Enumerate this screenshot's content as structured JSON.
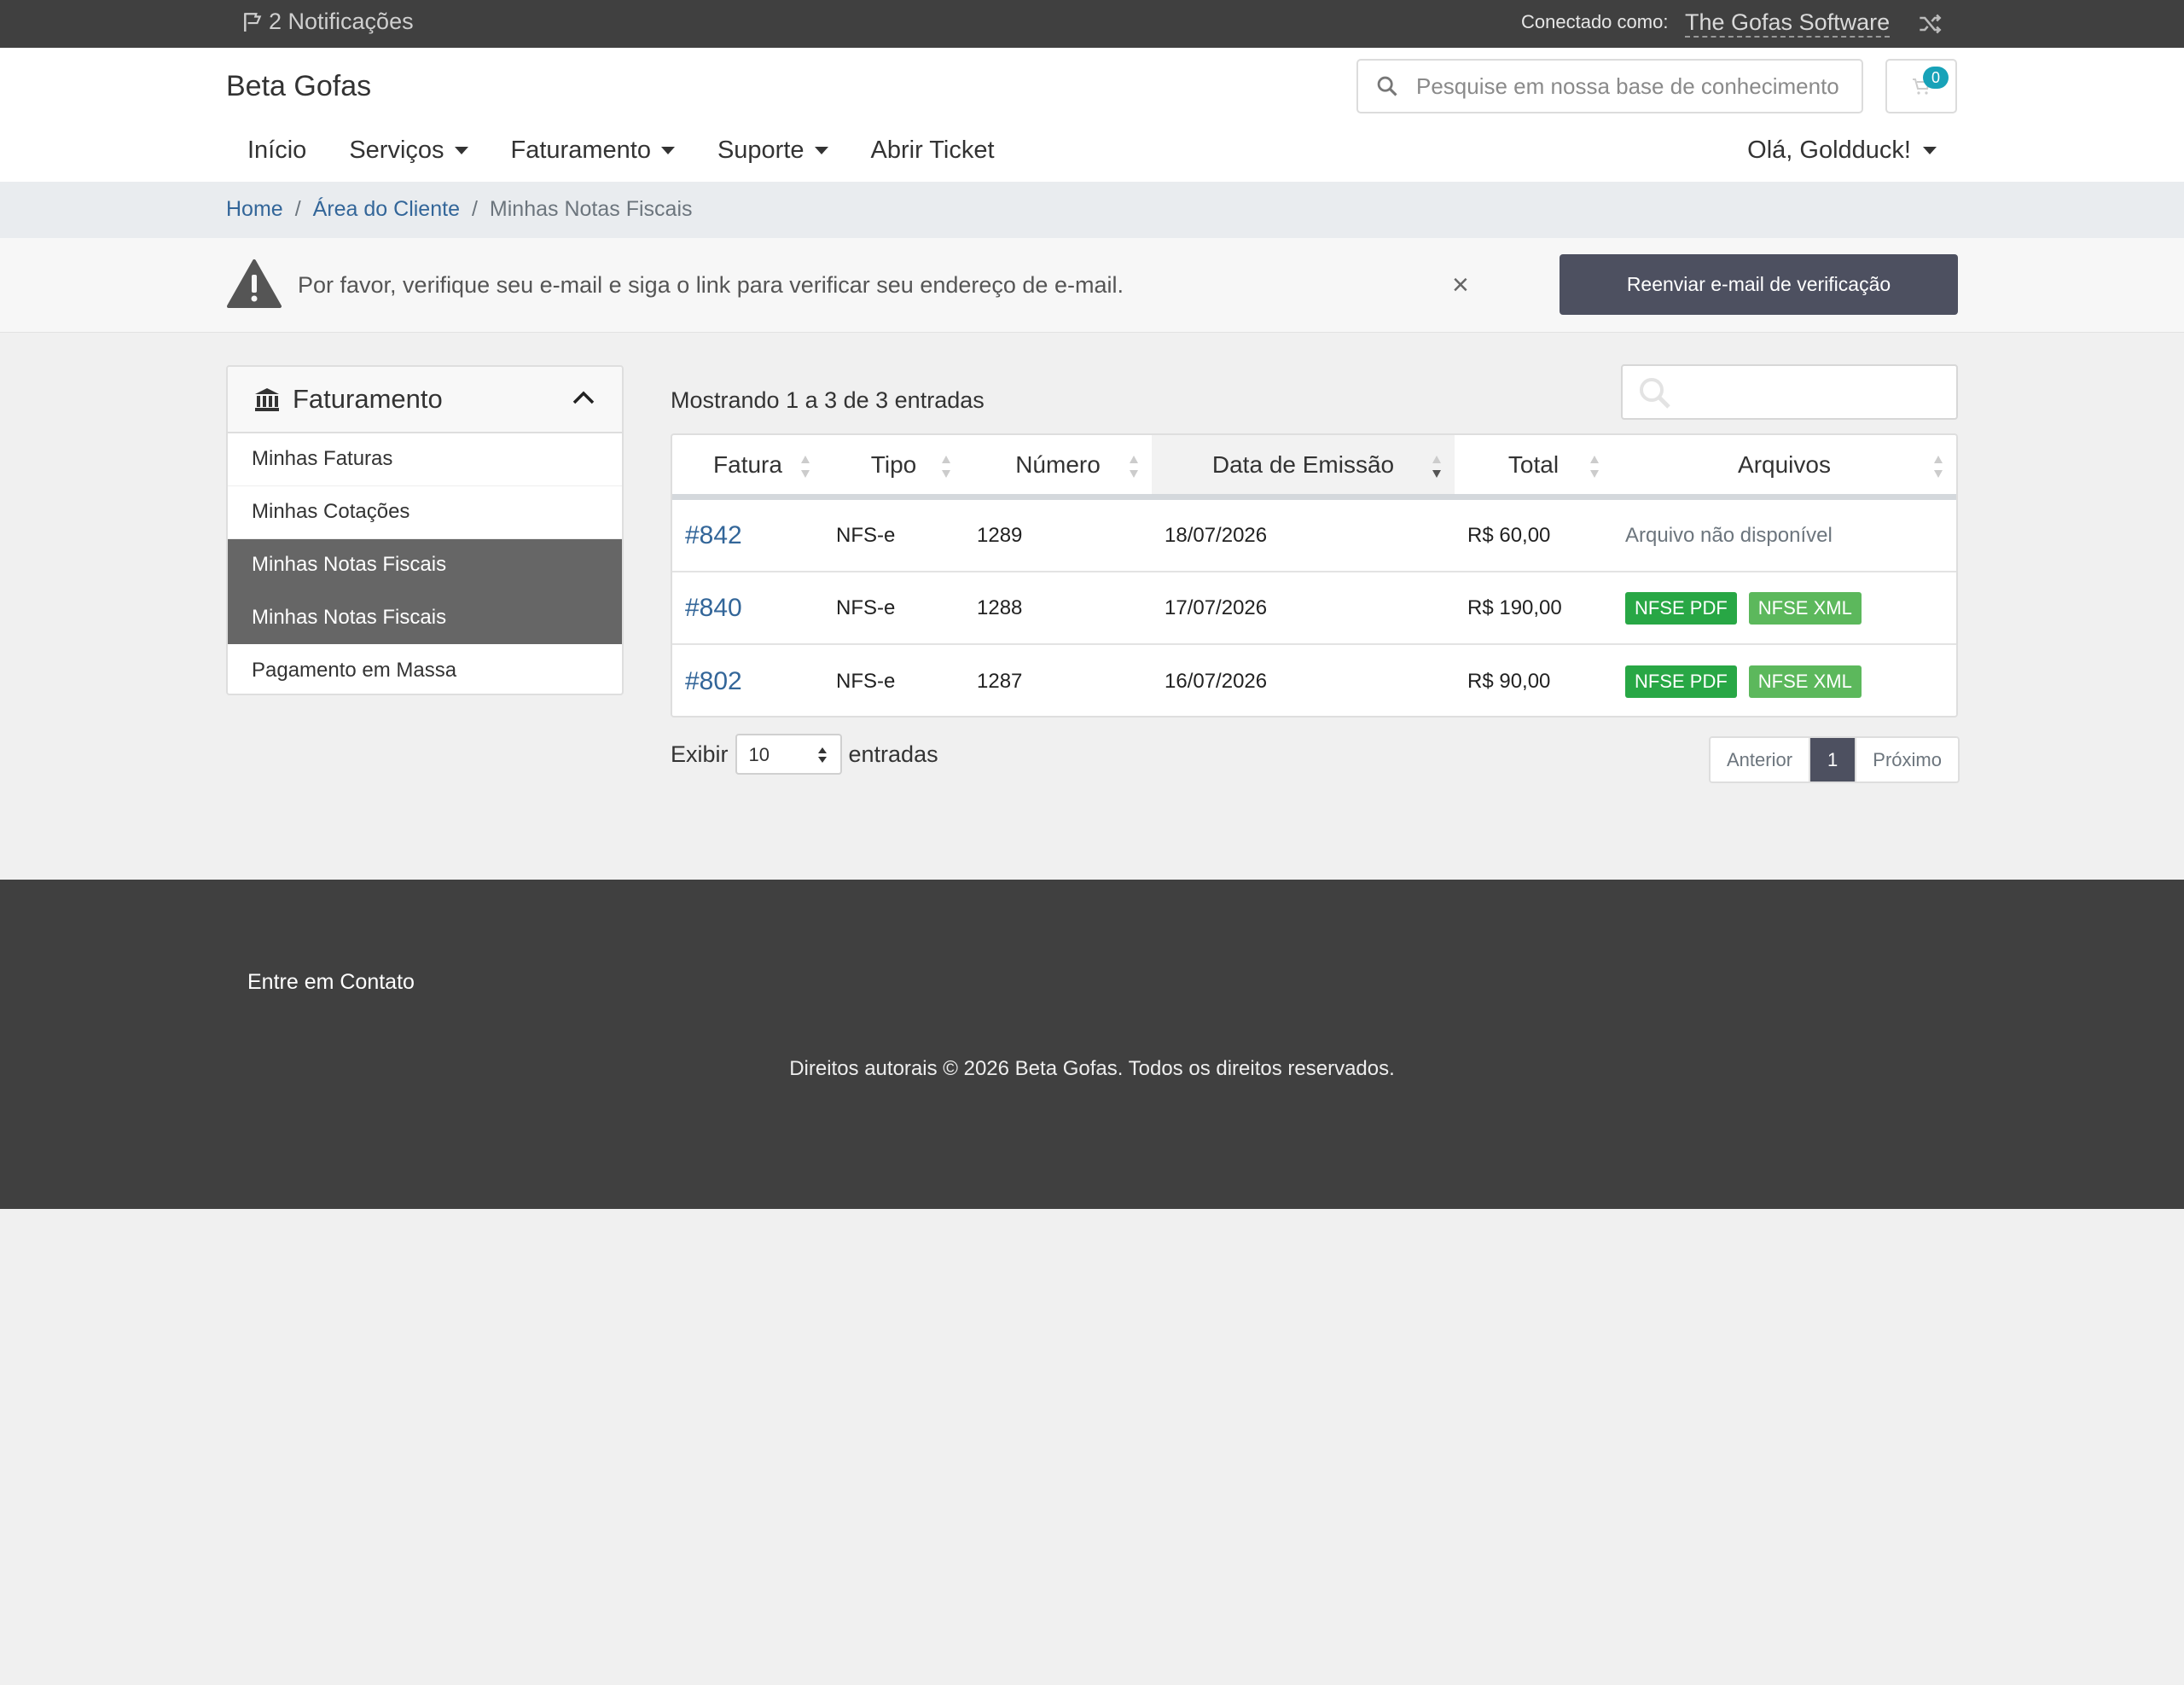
{
  "topbar": {
    "notifications": "2 Notificações",
    "connected_label": "Conectado como:",
    "account_name": "The Gofas Software"
  },
  "header": {
    "brand": "Beta Gofas",
    "search_placeholder": "Pesquise em nossa base de conhecimento",
    "cart_count": "0",
    "nav": [
      {
        "label": "Início",
        "dropdown": false
      },
      {
        "label": "Serviços",
        "dropdown": true
      },
      {
        "label": "Faturamento",
        "dropdown": true
      },
      {
        "label": "Suporte",
        "dropdown": true
      },
      {
        "label": "Abrir Ticket",
        "dropdown": false
      }
    ],
    "user_greeting": "Olá, Goldduck!"
  },
  "breadcrumb": {
    "items": [
      "Home",
      "Área do Cliente",
      "Minhas Notas Fiscais"
    ],
    "separator": "/"
  },
  "alert": {
    "message": "Por favor, verifique seu e-mail e siga o link para verificar seu endereço de e-mail.",
    "close": "×",
    "button": "Reenviar e-mail de verificação"
  },
  "sidebar": {
    "title": "Faturamento",
    "items": [
      {
        "label": "Minhas Faturas",
        "active": false
      },
      {
        "label": "Minhas Cotações",
        "active": false
      },
      {
        "label": "Minhas Notas Fiscais",
        "active": true
      },
      {
        "label": "Minhas Notas Fiscais",
        "active": true
      },
      {
        "label": "Pagamento em Massa",
        "active": false
      }
    ]
  },
  "table": {
    "showing": "Mostrando 1 a 3 de 3 entradas",
    "columns": [
      "Fatura",
      "Tipo",
      "Número",
      "Data de Emissão",
      "Total",
      "Arquivos"
    ],
    "sorted_column": "Data de Emissão",
    "rows": [
      {
        "invoice": "#842",
        "type": "NFS-e",
        "number": "1289",
        "date": "18/07/2026",
        "total": "R$ 60,00",
        "files_text": "Arquivo não disponível",
        "pdf": "",
        "xml": ""
      },
      {
        "invoice": "#840",
        "type": "NFS-e",
        "number": "1288",
        "date": "17/07/2026",
        "total": "R$ 190,00",
        "files_text": "",
        "pdf": "NFSE PDF",
        "xml": "NFSE XML"
      },
      {
        "invoice": "#802",
        "type": "NFS-e",
        "number": "1287",
        "date": "16/07/2026",
        "total": "R$ 90,00",
        "files_text": "",
        "pdf": "NFSE PDF",
        "xml": "NFSE XML"
      }
    ],
    "show_label": "Exibir",
    "show_value": "10",
    "entries_label": "entradas",
    "pagination": {
      "prev": "Anterior",
      "current": "1",
      "next": "Próximo"
    }
  },
  "footer": {
    "contact": "Entre em Contato",
    "copyright": "Direitos autorais © 2026 Beta Gofas. Todos os direitos reservados."
  },
  "colors": {
    "topbar_bg": "#404040",
    "link": "#336699",
    "active_sidebar": "#666666",
    "button_dark": "#4d5060",
    "pdf_green": "#28a745",
    "xml_green": "#5cb85c",
    "badge": "#17a2b8"
  }
}
